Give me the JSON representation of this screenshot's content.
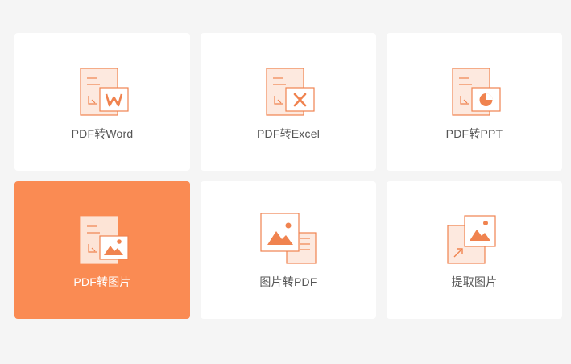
{
  "colors": {
    "page_bg": "#f5f5f5",
    "card_bg": "#ffffff",
    "accent": "#fa8b53",
    "icon_stroke": "#f0834f",
    "icon_fill": "#fde9df",
    "label_text": "#555555",
    "active_label_text": "#ffffff"
  },
  "tools": [
    {
      "label": "PDF转Word",
      "icon": "pdf-to-word-icon",
      "selected": false
    },
    {
      "label": "PDF转Excel",
      "icon": "pdf-to-excel-icon",
      "selected": false
    },
    {
      "label": "PDF转PPT",
      "icon": "pdf-to-ppt-icon",
      "selected": false
    },
    {
      "label": "PDF转图片",
      "icon": "pdf-to-image-icon",
      "selected": true
    },
    {
      "label": "图片转PDF",
      "icon": "image-to-pdf-icon",
      "selected": false
    },
    {
      "label": "提取图片",
      "icon": "extract-image-icon",
      "selected": false
    }
  ]
}
